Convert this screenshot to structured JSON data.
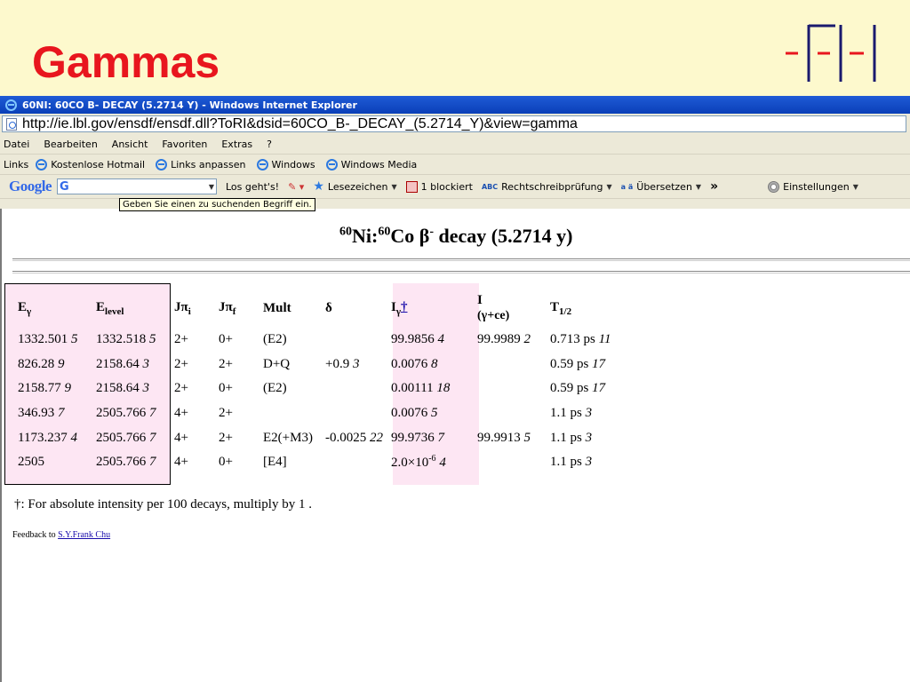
{
  "slide": {
    "title": "Gammas"
  },
  "browser": {
    "window_title": "60NI: 60CO B- DECAY (5.2714 Y) - Windows Internet Explorer",
    "address": "http://ie.lbl.gov/ensdf/ensdf.dll?ToRI&dsid=60CO_B-_DECAY_(5.2714_Y)&view=gamma",
    "menu": [
      "Datei",
      "Bearbeiten",
      "Ansicht",
      "Favoriten",
      "Extras",
      "?"
    ],
    "links_label": "Links",
    "links": [
      "Kostenlose Hotmail",
      "Links anpassen",
      "Windows",
      "Windows Media"
    ],
    "google_toolbar": {
      "logo": "Google",
      "search_g": "G",
      "go_button": "Los geht's!",
      "bookmarks": "Lesezeichen",
      "blocked": "1 blockiert",
      "spellcheck": "Rechtschreibprüfung",
      "translate": "Übersetzen",
      "more": "»",
      "settings": "Einstellungen",
      "abc_icon": "ABC",
      "translate_icon": "a ä"
    },
    "tooltip": "Geben Sie einen zu suchenden Begriff ein."
  },
  "document": {
    "title_parts": {
      "sup1": "60",
      "ni": "Ni:",
      "sup2": "60",
      "co": "Co",
      "beta": "β",
      "sup3": "-",
      "rest": " decay (5.2714 y)"
    },
    "columns": {
      "e_gamma": "E",
      "e_gamma_sub": "γ",
      "e_level": "E",
      "e_level_sub": "level",
      "jpi_i": "Jπ",
      "jpi_i_sub": "i",
      "jpi_f": "Jπ",
      "jpi_f_sub": "f",
      "mult": "Mult",
      "delta": "δ",
      "i_gamma": "I",
      "i_gamma_sub": "γ",
      "i_gamma_mark": "†",
      "i_total": "I",
      "i_total_2": "(γ+ce)",
      "t_half": "T",
      "t_half_sub": "1/2"
    },
    "rows": [
      {
        "eg": "1332.501",
        "eg_unc": "5",
        "el": "1332.518",
        "el_unc": "5",
        "ji": "2+",
        "jf": "0+",
        "mult": "(E2)",
        "delta": "",
        "delta_unc": "",
        "ig": "99.9856",
        "ig_unc": "4",
        "itot": "99.9989",
        "itot_unc": "2",
        "t": "0.713 ps",
        "t_unc": "11"
      },
      {
        "eg": "826.28",
        "eg_unc": "9",
        "el": "2158.64",
        "el_unc": "3",
        "ji": "2+",
        "jf": "2+",
        "mult": "D+Q",
        "delta": "+0.9",
        "delta_unc": "3",
        "ig": "0.0076",
        "ig_unc": "8",
        "itot": "",
        "itot_unc": "",
        "t": "0.59 ps",
        "t_unc": "17"
      },
      {
        "eg": "2158.77",
        "eg_unc": "9",
        "el": "2158.64",
        "el_unc": "3",
        "ji": "2+",
        "jf": "0+",
        "mult": "(E2)",
        "delta": "",
        "delta_unc": "",
        "ig": "0.00111",
        "ig_unc": "18",
        "itot": "",
        "itot_unc": "",
        "t": "0.59 ps",
        "t_unc": "17"
      },
      {
        "eg": "346.93",
        "eg_unc": "7",
        "el": "2505.766",
        "el_unc": "7",
        "ji": "4+",
        "jf": "2+",
        "mult": "",
        "delta": "",
        "delta_unc": "",
        "ig": "0.0076",
        "ig_unc": "5",
        "itot": "",
        "itot_unc": "",
        "t": "1.1 ps",
        "t_unc": "3"
      },
      {
        "eg": "1173.237",
        "eg_unc": "4",
        "el": "2505.766",
        "el_unc": "7",
        "ji": "4+",
        "jf": "2+",
        "mult": "E2(+M3)",
        "delta": "-0.0025",
        "delta_unc": "22",
        "ig": "99.9736",
        "ig_unc": "7",
        "itot": "99.9913",
        "itot_unc": "5",
        "t": "1.1 ps",
        "t_unc": "3"
      },
      {
        "eg": "2505",
        "eg_unc": "",
        "el": "2505.766",
        "el_unc": "7",
        "ji": "4+",
        "jf": "0+",
        "mult": "[E4]",
        "delta": "",
        "delta_unc": "",
        "ig": "2.0×10",
        "ig_exp": "-6",
        "ig_unc": "4",
        "itot": "",
        "itot_unc": "",
        "t": "1.1 ps",
        "t_unc": "3"
      }
    ],
    "footnote": "†: For absolute intensity per 100 decays, multiply by 1 .",
    "feedback_label": "Feedback to ",
    "feedback_link": "S.Y.Frank Chu"
  }
}
